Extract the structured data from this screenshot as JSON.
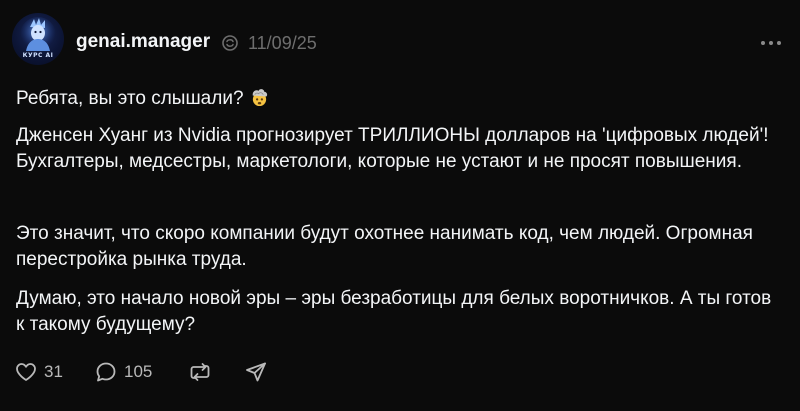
{
  "post": {
    "avatar_label": "КУРС AI",
    "username": "genai.manager",
    "timestamp": "11/09/25",
    "paragraphs": [
      "Ребята, вы это слышали?",
      "Дженсен Хуанг из Nvidia прогнозирует ТРИЛЛИОНЫ долларов на 'цифровых людей'! Бухгалтеры, медсестры, маркетологи, которые не устают и не просят повышения.",
      "Это значит, что скоро компании будут охотнее нанимать код, чем людей. Огромная перестройка рынка труда.",
      "Думаю, это начало новой эры – эры безработицы для белых воротничков. А ты готов к такому будущему?"
    ],
    "emoji": "exploding-head-emoji",
    "actions": {
      "likes": "31",
      "replies": "105"
    }
  },
  "colors": {
    "background": "#0b0b0b",
    "text": "#f3f5f7",
    "muted": "#6e6e6e",
    "icon": "#b9b9b9"
  }
}
